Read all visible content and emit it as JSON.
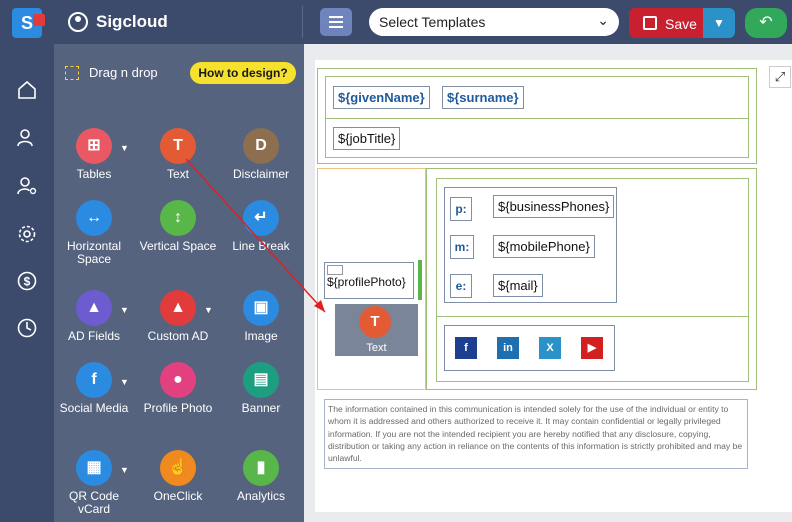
{
  "app": {
    "name": "Sigcloud"
  },
  "toolbar": {
    "template_placeholder": "Select Templates",
    "save_label": "Save"
  },
  "panel": {
    "drag_label": "Drag n drop",
    "howto_label": "How to design?",
    "tools": [
      {
        "label": "Tables",
        "color": "#ea5863",
        "icon": "table-icon"
      },
      {
        "label": "Text",
        "color": "#e35b34",
        "icon": "text-icon"
      },
      {
        "label": "Disclaimer",
        "color": "#8d6e4e",
        "icon": "disclaimer-icon"
      },
      {
        "label": "Horizontal Space",
        "color": "#2a8be0",
        "icon": "horizontal-space-icon"
      },
      {
        "label": "Vertical Space",
        "color": "#59b649",
        "icon": "vertical-space-icon"
      },
      {
        "label": "Line Break",
        "color": "#2a8be0",
        "icon": "line-break-icon"
      },
      {
        "label": "AD Fields",
        "color": "#6c5ccf",
        "icon": "ad-fields-icon"
      },
      {
        "label": "Custom AD",
        "color": "#e23b3b",
        "icon": "custom-ad-icon"
      },
      {
        "label": "Image",
        "color": "#2a8be0",
        "icon": "image-icon"
      },
      {
        "label": "Social Media",
        "color": "#2a8be0",
        "icon": "social-media-icon"
      },
      {
        "label": "Profile Photo",
        "color": "#e2407e",
        "icon": "profile-photo-icon"
      },
      {
        "label": "Banner",
        "color": "#1e9e80",
        "icon": "banner-icon"
      },
      {
        "label": "QR Code vCard",
        "color": "#2a8be0",
        "icon": "qr-code-icon"
      },
      {
        "label": "OneClick",
        "color": "#f08a1e",
        "icon": "oneclick-icon"
      },
      {
        "label": "Analytics",
        "color": "#59b649",
        "icon": "analytics-icon"
      }
    ]
  },
  "signature": {
    "given_name": "${givenName}",
    "surname": "${surname}",
    "job_title": "${jobTitle}",
    "profile_photo": "${profilePhoto}",
    "phone_label": "p:",
    "phone": "${businessPhones}",
    "mobile_label": "m:",
    "mobile": "${mobilePhone}",
    "email_label": "e:",
    "email": "${mail}",
    "disclaimer": "The information contained in this communication is intended solely for the use of the individual or entity to whom it is addressed and others authorized to receive it. It may contain confidential or legally privileged information. If you are not the intended recipient you are hereby notified that any disclosure, copying, distribution or taking any action in reliance on the contents of this information is strictly prohibited and may be unlawful."
  },
  "drag_ghost": {
    "label": "Text"
  },
  "colors": {
    "accent": "#3c4a6b",
    "save": "#c8202e",
    "undo": "#32a85a",
    "arrow": "#e02020"
  }
}
